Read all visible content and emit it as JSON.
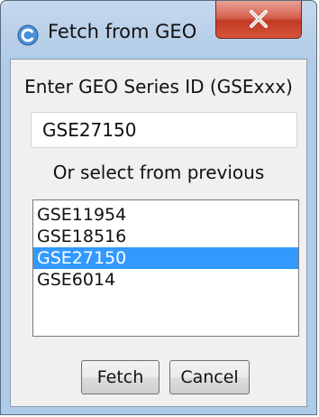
{
  "window": {
    "title": "Fetch from GEO",
    "app_icon": "app-logo-icon",
    "close_icon": "close-icon"
  },
  "form": {
    "prompt_label": "Enter GEO Series ID (GSExxx)",
    "series_id_value": "GSE27150",
    "or_label": "Or select from previous",
    "previous_series": [
      {
        "label": "GSE11954",
        "selected": false
      },
      {
        "label": "GSE18516",
        "selected": false
      },
      {
        "label": "GSE27150",
        "selected": true
      },
      {
        "label": "GSE6014",
        "selected": false
      }
    ]
  },
  "buttons": {
    "fetch_label": "Fetch",
    "cancel_label": "Cancel"
  },
  "colors": {
    "selection": "#3399ff",
    "close_button": "#c23a24",
    "titlebar": "#b9cfe8"
  }
}
